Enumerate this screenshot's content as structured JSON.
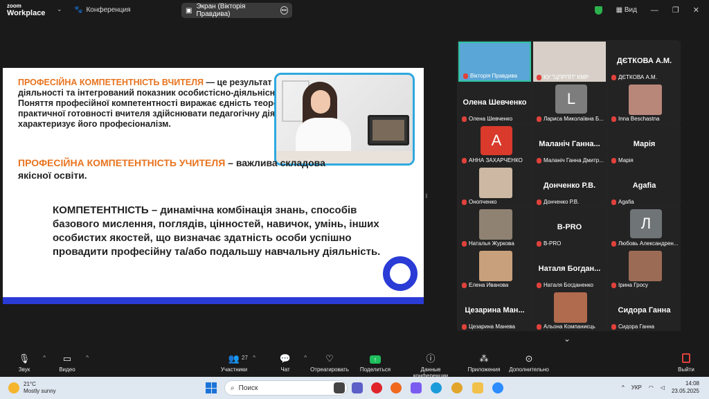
{
  "app": {
    "logo_line1": "zoom",
    "logo_line2": "Workplace",
    "conference_label": "Конференция",
    "screen_pill": "Экран (Вікторія Правдива)",
    "view_label": "Вид"
  },
  "slide": {
    "p1_lead": "ПРОФЕСІЙНА КОМПЕТЕНТНІСТЬ ВЧИТЕЛЯ",
    "p1_rest": " — це результат творчої професійної діяльності та інтегрований показник особистісно-діяльнісної сутності педагога. Поняття професійної компетентності виражає єдність теоретичної та практичної готовності вчителя здійснювати педагогічну діяльність і характеризує його професіоналізм.",
    "p2_lead": "ПРОФЕСІЙНА КОМПЕТЕНТНІСТЬ УЧИТЕЛЯ",
    "p2_rest": " – важлива складова якісної освіти.",
    "p3": "КОМПЕТЕНТНІСТЬ – динамічна комбінація знань, способів базового мислення, поглядів, цінностей, навичок, умінь, інших особистих якостей, що визначає здатність особи успішно провадити професійну та/або подальшу навчальну діяльність."
  },
  "participants": [
    {
      "label": "Вікторія Правдива",
      "big": "",
      "kind": "video",
      "color": "#5aa6d6"
    },
    {
      "label": "КУ \"ЦПРПП\" КМР",
      "big": "",
      "kind": "video",
      "color": "#d8d0c8"
    },
    {
      "label": "ДЄТКОВА А.М.",
      "big": "ДЄТКОВА А.М.",
      "kind": "name"
    },
    {
      "label": "Олена Шевченко",
      "big": "Олена Шевченко",
      "kind": "name"
    },
    {
      "label": "Лариса Миколаївна Б...",
      "big": "L",
      "kind": "avatar",
      "color": "#7d7d7d"
    },
    {
      "label": "Inna Beschastna",
      "big": "",
      "kind": "video",
      "color": "#b9867a"
    },
    {
      "label": "АННА ЗАХАРЧЕНКО",
      "big": "A",
      "kind": "avatar",
      "color": "#d93a2b"
    },
    {
      "label": "Маланіч Ганна Дмитр...",
      "big": "Маланіч Ганна...",
      "kind": "name"
    },
    {
      "label": "Марія",
      "big": "Марія",
      "kind": "name"
    },
    {
      "label": "Онопченко",
      "big": "",
      "kind": "video",
      "color": "#cdb9a3"
    },
    {
      "label": "Донченко Р.В.",
      "big": "Донченко Р.В.",
      "kind": "name"
    },
    {
      "label": "Agafia",
      "big": "Agafia",
      "kind": "name"
    },
    {
      "label": "Наталья Журкова",
      "big": "",
      "kind": "video",
      "color": "#8f8272"
    },
    {
      "label": "B-PRO",
      "big": "B-PRO",
      "kind": "name"
    },
    {
      "label": "Любовь Александрен...",
      "big": "Л",
      "kind": "avatar",
      "color": "#6f7476"
    },
    {
      "label": "Елена Иванова",
      "big": "",
      "kind": "video",
      "color": "#c9a07c"
    },
    {
      "label": "Наталя Богданенко",
      "big": "Наталя Богдан...",
      "kind": "name"
    },
    {
      "label": "Ірина Гросу",
      "big": "",
      "kind": "video",
      "color": "#9c6b55"
    },
    {
      "label": "Цезарина Манева",
      "big": "Цезарина Ман...",
      "kind": "name"
    },
    {
      "label": "Альона Компаниєць",
      "big": "",
      "kind": "video",
      "color": "#b06a4e"
    },
    {
      "label": "Сидора Ганна",
      "big": "Сидора Ганна",
      "kind": "name"
    }
  ],
  "toolbar": {
    "audio": "Звук",
    "video": "Видео",
    "participants": "Участники",
    "participants_count": "27",
    "chat": "Чат",
    "react": "Отреагировать",
    "share": "Поделиться",
    "info": "Данные конференции",
    "apps": "Приложения",
    "more": "Дополнительно",
    "leave": "Выйти"
  },
  "taskbar": {
    "temp": "21°C",
    "weather": "Mostly sunny",
    "search_placeholder": "Поиск",
    "lang": "УКР",
    "time": "14:08",
    "date": "23.05.2025"
  }
}
